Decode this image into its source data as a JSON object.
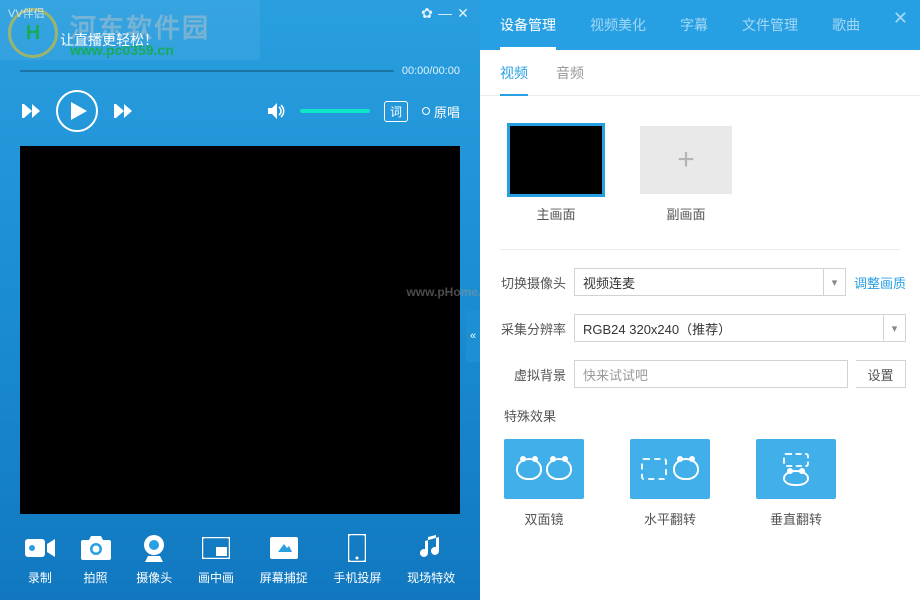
{
  "titlebar": {
    "title": "VV伴侣"
  },
  "tagline": "让直播更轻松！",
  "watermark": {
    "brand": "河东软件园",
    "url": "www.pc0359.cn",
    "side": "www.pHome.N"
  },
  "time": {
    "current": "00:00",
    "total": "00:00"
  },
  "player": {
    "lyric_label": "词",
    "original_label": "原唱"
  },
  "bottom_tools": [
    {
      "id": "record",
      "label": "录制"
    },
    {
      "id": "photo",
      "label": "拍照"
    },
    {
      "id": "camera",
      "label": "摄像头"
    },
    {
      "id": "pip",
      "label": "画中画"
    },
    {
      "id": "screencap",
      "label": "屏幕捕捉"
    },
    {
      "id": "phonecast",
      "label": "手机投屏"
    },
    {
      "id": "scenefx",
      "label": "现场特效"
    }
  ],
  "right_tabs": [
    {
      "label": "设备管理",
      "active": true
    },
    {
      "label": "视频美化"
    },
    {
      "label": "字幕"
    },
    {
      "label": "文件管理"
    },
    {
      "label": "歌曲"
    }
  ],
  "subtabs": [
    {
      "label": "视频",
      "active": true
    },
    {
      "label": "音频"
    }
  ],
  "thumbs": {
    "main": "主画面",
    "sub": "副画面"
  },
  "form": {
    "camera_label": "切换摄像头",
    "camera_value": "视频连麦",
    "adjust_quality": "调整画质",
    "resolution_label": "采集分辨率",
    "resolution_value": "RGB24 320x240（推荐）",
    "virtualbg_label": "虚拟背景",
    "virtualbg_placeholder": "快来试试吧",
    "setting_btn": "设置"
  },
  "effects": {
    "title": "特殊效果",
    "items": [
      {
        "id": "mirror",
        "label": "双面镜"
      },
      {
        "id": "hflip",
        "label": "水平翻转"
      },
      {
        "id": "vflip",
        "label": "垂直翻转"
      }
    ]
  }
}
